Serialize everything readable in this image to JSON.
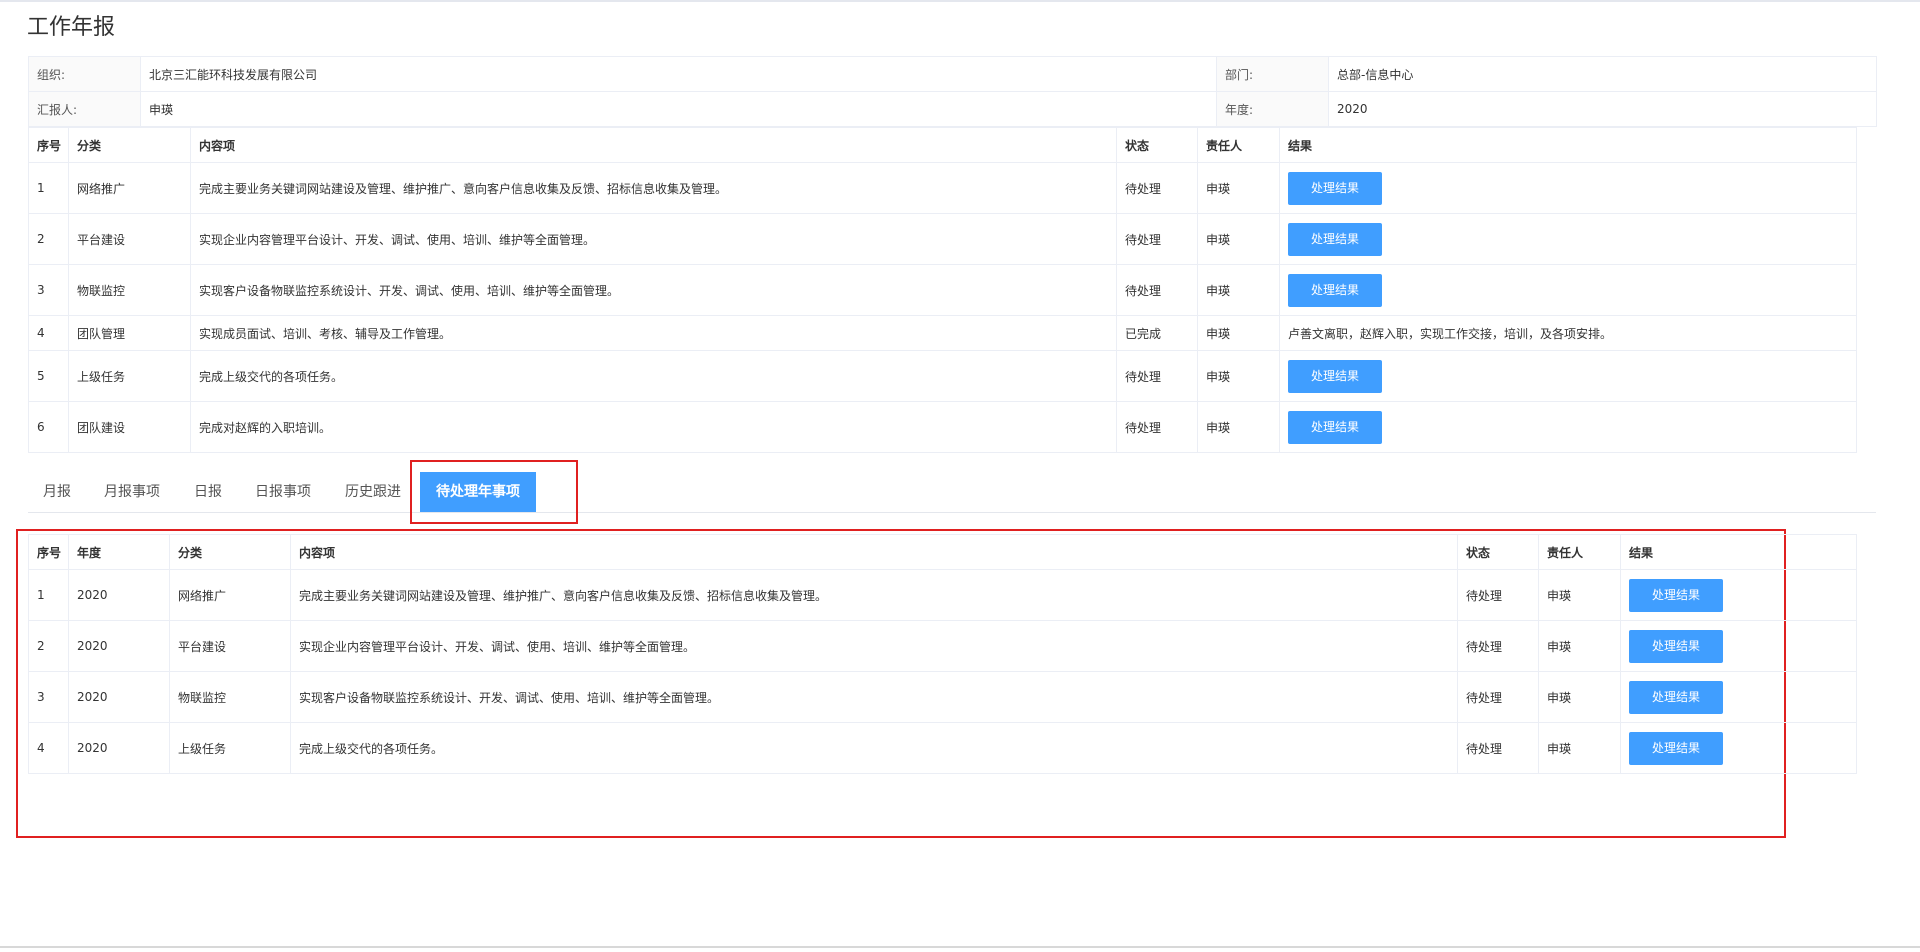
{
  "page": {
    "title": "工作年报"
  },
  "info": {
    "org_label": "组织:",
    "org_value": "北京三汇能环科技发展有限公司",
    "dept_label": "部门:",
    "dept_value": "总部-信息中心",
    "reporter_label": "汇报人:",
    "reporter_value": "申瑛",
    "year_label": "年度:",
    "year_value": "2020"
  },
  "items_table": {
    "headers": [
      "序号",
      "分类",
      "内容项",
      "状态",
      "责任人",
      "结果"
    ],
    "rows": [
      {
        "no": "1",
        "category": "网络推广",
        "content": "完成主要业务关键词网站建设及管理、维护推广、意向客户信息收集及反馈、招标信息收集及管理。",
        "status": "待处理",
        "owner": "申瑛",
        "button": "处理结果"
      },
      {
        "no": "2",
        "category": "平台建设",
        "content": "实现企业内容管理平台设计、开发、调试、使用、培训、维护等全面管理。",
        "status": "待处理",
        "owner": "申瑛",
        "button": "处理结果"
      },
      {
        "no": "3",
        "category": "物联监控",
        "content": "实现客户设备物联监控系统设计、开发、调试、使用、培训、维护等全面管理。",
        "status": "待处理",
        "owner": "申瑛",
        "button": "处理结果"
      },
      {
        "no": "4",
        "category": "团队管理",
        "content": "实现成员面试、培训、考核、辅导及工作管理。",
        "status": "已完成",
        "owner": "申瑛",
        "result_text": "卢善文离职，赵辉入职，实现工作交接，培训，及各项安排。"
      },
      {
        "no": "5",
        "category": "上级任务",
        "content": "完成上级交代的各项任务。",
        "status": "待处理",
        "owner": "申瑛",
        "button": "处理结果"
      },
      {
        "no": "6",
        "category": "团队建设",
        "content": "完成对赵辉的入职培训。",
        "status": "待处理",
        "owner": "申瑛",
        "button": "处理结果"
      }
    ]
  },
  "tabs": [
    {
      "label": "月报"
    },
    {
      "label": "月报事项"
    },
    {
      "label": "日报"
    },
    {
      "label": "日报事项"
    },
    {
      "label": "历史跟进"
    },
    {
      "label": "待处理年事项",
      "active": true
    }
  ],
  "pending_table": {
    "headers": [
      "序号",
      "年度",
      "分类",
      "内容项",
      "状态",
      "责任人",
      "结果"
    ],
    "rows": [
      {
        "no": "1",
        "year": "2020",
        "category": "网络推广",
        "content": "完成主要业务关键词网站建设及管理、维护推广、意向客户信息收集及反馈、招标信息收集及管理。",
        "status": "待处理",
        "owner": "申瑛",
        "button": "处理结果"
      },
      {
        "no": "2",
        "year": "2020",
        "category": "平台建设",
        "content": "实现企业内容管理平台设计、开发、调试、使用、培训、维护等全面管理。",
        "status": "待处理",
        "owner": "申瑛",
        "button": "处理结果"
      },
      {
        "no": "3",
        "year": "2020",
        "category": "物联监控",
        "content": "实现客户设备物联监控系统设计、开发、调试、使用、培训、维护等全面管理。",
        "status": "待处理",
        "owner": "申瑛",
        "button": "处理结果"
      },
      {
        "no": "4",
        "year": "2020",
        "category": "上级任务",
        "content": "完成上级交代的各项任务。",
        "status": "待处理",
        "owner": "申瑛",
        "button": "处理结果"
      }
    ]
  },
  "colors": {
    "accent": "#409eff",
    "link": "#4a8ef0",
    "highlight": "#e02020",
    "border": "#ebeef5"
  }
}
